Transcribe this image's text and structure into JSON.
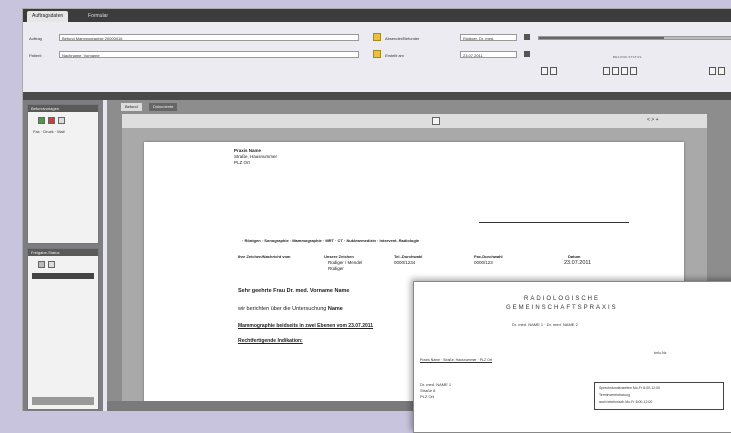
{
  "tabs": [
    {
      "label": "Auftragsdaten"
    },
    {
      "label": "Formular"
    }
  ],
  "header": {
    "auftrag_label": "Auftrag",
    "auftrag_value": "Befund Mammographie 20000016",
    "patient_label": "Patient",
    "patient_value": "Nachname, Vorname",
    "absender_label": "Absender/Befunder",
    "absender_value": "Rüdiger, Dr. med.",
    "datum_label": "Erstellt am",
    "datum_value": "23.07.2011",
    "range_label": "BEFUND-STATUS",
    "slider_fill_percent": 65
  },
  "left_panel": {
    "box1_title": "Befundvorlagen",
    "box1_item": "Fax · Druck · Mail",
    "box2_title": "Freigabe-Status"
  },
  "content_tabs": [
    {
      "label": "Befund"
    },
    {
      "label": "Dokumente"
    }
  ],
  "toolbar": {
    "zoom_label": "< > +"
  },
  "doc": {
    "addr1": "Praxis Name",
    "addr2": "Straße, Hausnummer",
    "addr3": "PLZ Ort",
    "categories": "· Röntgen · Sonographie · Mammographie · MRT · CT · Nuklearmedizin · Intervent. Radiologie",
    "h_sender": "Ihre Zeichen/Nachricht vom",
    "h_unsere": "Unsere Zeichen",
    "h_tel": "Tel.-Durchwahl",
    "h_fax": "Fax-Durchwahl",
    "h_datum": "Datum",
    "v_unsere1": "Rüdiger / Mendel",
    "v_unsere2": "Rüdiger",
    "v_tel": "0000/1234",
    "v_fax": "0000/123",
    "v_datum": "23.07.2011",
    "salutation": "Sehr geehrte Frau Dr. med. Vorname Name",
    "line2_prefix": "wir berichten über die Untersuchung",
    "line2_bold": "Name",
    "line3": "Mammographie beidseits in zwei Ebenen vom 23.07.2011",
    "line4": "Rechtfertigende Indikation:"
  },
  "overlay": {
    "title1": "RADIOLOGISCHE",
    "title2": "GEMEINSCHAFTSPRAXIS",
    "subtitle": "Dr. med. NAME 1 · Dr. med. NAME 2",
    "sender_line": "Praxis Name · Straße, Hausnummer · PLZ Ort",
    "ref": "Info-Nr.",
    "addr1": "Dr. med. NAME 1",
    "addr2": "Straße 8",
    "addr3": "PLZ Ort",
    "box_line1": "Sprechstundenzeiten  Mo-Fr 8:00-12:00",
    "box_line2": "Terminvereinbarung",
    "box_line3": "auch telefonisch  Mo-Fr 8:00-12:00"
  }
}
